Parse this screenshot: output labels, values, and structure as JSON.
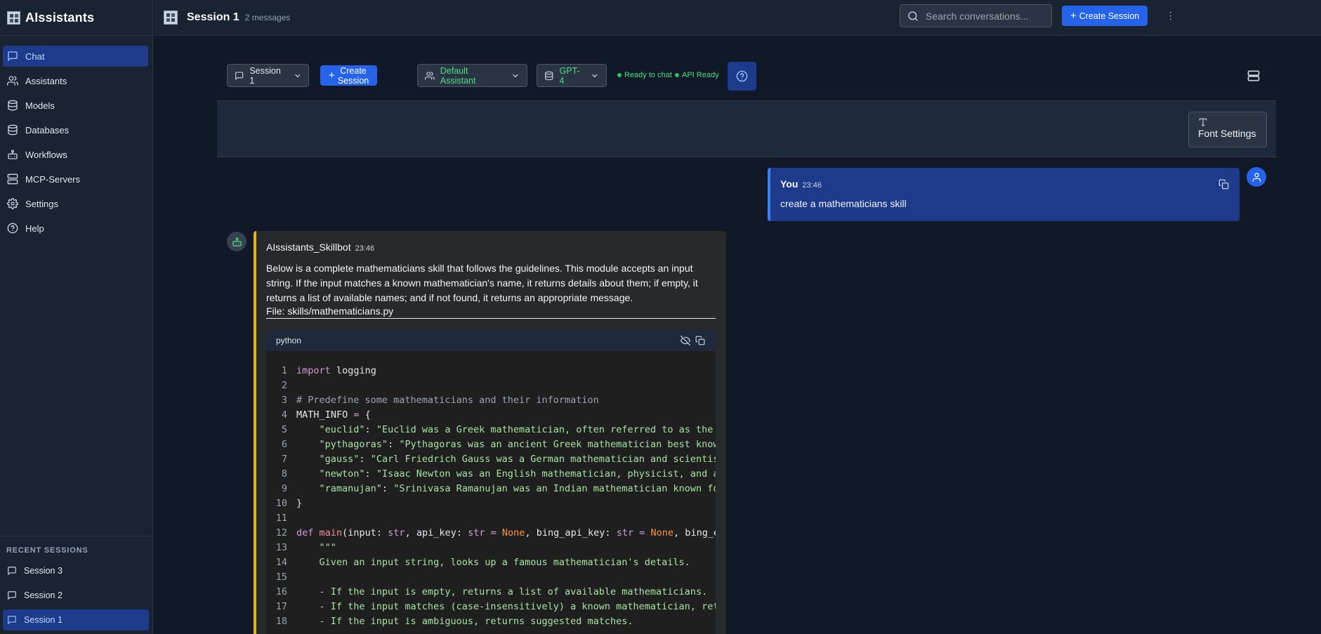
{
  "app": {
    "title": "AIssistants"
  },
  "sidebar": {
    "items": [
      {
        "label": "Chat",
        "icon": "message-square-icon",
        "active": true
      },
      {
        "label": "Assistants",
        "icon": "users-icon"
      },
      {
        "label": "Models",
        "icon": "database-icon"
      },
      {
        "label": "Databases",
        "icon": "database-icon"
      },
      {
        "label": "Workflows",
        "icon": "bot-icon"
      },
      {
        "label": "MCP-Servers",
        "icon": "server-icon"
      },
      {
        "label": "Settings",
        "icon": "gear-icon"
      },
      {
        "label": "Help",
        "icon": "help-circle-icon"
      }
    ],
    "recent_title": "RECENT SESSIONS",
    "recent": [
      {
        "label": "Session 3"
      },
      {
        "label": "Session 2"
      },
      {
        "label": "Session 1",
        "active": true
      }
    ]
  },
  "header": {
    "session_title": "Session 1",
    "message_count": "2 messages",
    "search_placeholder": "Search conversations...",
    "create_label": "Create Session"
  },
  "toolbar": {
    "session_select": "Session 1",
    "create_label": "Create Session",
    "assistant_select": "Default Assistant",
    "model_select": "GPT-4",
    "status_chat": "Ready to chat",
    "status_api": "API Ready",
    "accent": "#2563eb"
  },
  "font_settings": {
    "label": "Font Settings"
  },
  "messages": [
    {
      "author": "You",
      "time": "23:46",
      "text": "create a mathematicians skill",
      "color": "#1e3a8a"
    },
    {
      "author": "AIssistants_Skillbot",
      "time": "23:46",
      "text": "Below is a complete mathematicians skill that follows the guidelines. This module accepts an input string. If the input matches a known mathematician's name, it returns details about them; if empty, it returns a list of available names; and if not found, it returns an appropriate message.",
      "file": "File: skills/mathematicians.py",
      "code_lang": "python",
      "color": "#eab308"
    }
  ],
  "code_lines": [
    {
      "n": "1",
      "code": "import logging"
    },
    {
      "n": "2",
      "code": ""
    },
    {
      "n": "3",
      "code": "# Predefine some mathematicians and their information"
    },
    {
      "n": "4",
      "code": "MATH_INFO = {"
    },
    {
      "n": "5",
      "code": "    \"euclid\": \"Euclid was a Greek mathematician, often referred to as the 'f"
    },
    {
      "n": "6",
      "code": "    \"pythagoras\": \"Pythagoras was an ancient Greek mathematician best known"
    },
    {
      "n": "7",
      "code": "    \"gauss\": \"Carl Friedrich Gauss was a German mathematician and scientist"
    },
    {
      "n": "8",
      "code": "    \"newton\": \"Isaac Newton was an English mathematician, physicist, and ast"
    },
    {
      "n": "9",
      "code": "    \"ramanujan\": \"Srinivasa Ramanujan was an Indian mathematician known for"
    },
    {
      "n": "10",
      "code": "}"
    },
    {
      "n": "11",
      "code": ""
    },
    {
      "n": "12",
      "code": "def main(input: str, api_key: str = None, bing_api_key: str = None, bing_enc"
    },
    {
      "n": "13",
      "code": "    \"\"\""
    },
    {
      "n": "14",
      "code": "    Given an input string, looks up a famous mathematician's details."
    },
    {
      "n": "15",
      "code": ""
    },
    {
      "n": "16",
      "code": "    - If the input is empty, returns a list of available mathematicians."
    },
    {
      "n": "17",
      "code": "    - If the input matches (case-insensitively) a known mathematician, retur"
    },
    {
      "n": "18",
      "code": "    - If the input is ambiguous, returns suggested matches."
    }
  ]
}
